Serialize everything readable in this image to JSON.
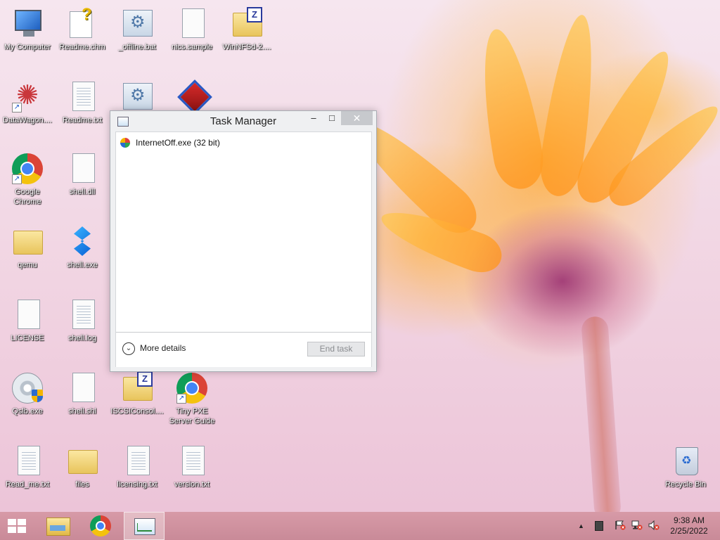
{
  "desktop": {
    "icons": [
      {
        "label": "My Computer"
      },
      {
        "label": "Readme.chm"
      },
      {
        "label": "_offline.bat"
      },
      {
        "label": "nics.sample"
      },
      {
        "label": "WinNFSd-2...."
      },
      {
        "label": "DataWagon...."
      },
      {
        "label": "Readme.txt"
      },
      {
        "label": "Google Chrome"
      },
      {
        "label": "shell.dll"
      },
      {
        "label": "qemu"
      },
      {
        "label": "shell.exe"
      },
      {
        "label": "LICENSE"
      },
      {
        "label": "shell.log"
      },
      {
        "label": "Qslb.exe"
      },
      {
        "label": "shell.shl"
      },
      {
        "label": "ISCSIConsol...."
      },
      {
        "label": "Tiny PXE Server Guide"
      },
      {
        "label": "Read_me.txt"
      },
      {
        "label": "files"
      },
      {
        "label": "licensing.txt"
      },
      {
        "label": "version.txt"
      },
      {
        "label": "Recycle Bin"
      }
    ]
  },
  "task_manager": {
    "title": "Task Manager",
    "controls": {
      "minimize": "–",
      "maximize": "□",
      "close": "✕"
    },
    "processes": [
      {
        "name": "InternetOff.exe (32 bit)",
        "icon": "globe-app-icon"
      }
    ],
    "more_details_label": "More details",
    "end_task_label": "End task",
    "end_task_enabled": false
  },
  "taskbar": {
    "pinned": [
      {
        "name": "File Explorer",
        "icon": "folder-icon"
      },
      {
        "name": "Google Chrome",
        "icon": "chrome-icon"
      },
      {
        "name": "Task Manager",
        "icon": "task-manager-icon",
        "active": true
      }
    ],
    "tray": {
      "chevron": "▲",
      "icons": [
        "flag-icon",
        "network-icon",
        "volume-muted-icon"
      ]
    },
    "clock": {
      "time": "9:38 AM",
      "date": "2/25/2022"
    }
  },
  "colors": {
    "taskbar": "#cf92a0",
    "window_bg": "#eff0f2",
    "close_button": "#c7c9cd"
  }
}
